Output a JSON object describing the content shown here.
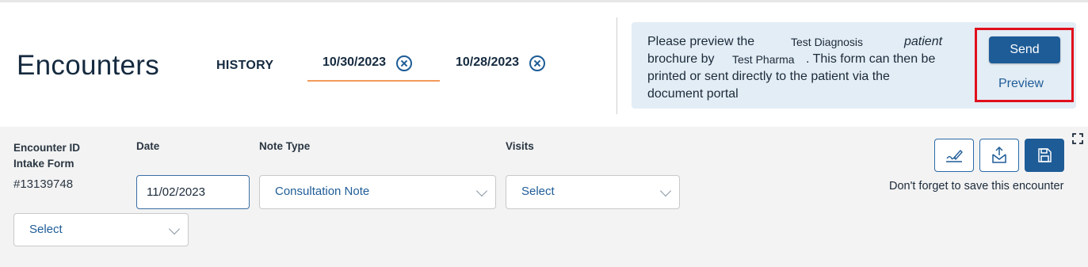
{
  "page": {
    "title": "Encounters"
  },
  "tabs": {
    "history_label": "HISTORY",
    "items": [
      {
        "label": "10/30/2023",
        "active": true
      },
      {
        "label": "10/28/2023",
        "active": false
      }
    ]
  },
  "notice": {
    "w1": "Please preview the",
    "diagnosis": "Test Diagnosis",
    "patient": "patient",
    "w2": "brochure by",
    "pharma": "Test Pharma",
    "w3": ". This form can then be",
    "w4": "printed or sent directly to the patient via the",
    "w5": "document portal",
    "send_label": "Send",
    "preview_label": "Preview"
  },
  "form": {
    "encounter_id_label": "Encounter ID",
    "intake_form_label": "Intake Form",
    "encounter_number": "#13139748",
    "date_label": "Date",
    "date_value": "11/02/2023",
    "note_type_label": "Note Type",
    "note_type_value": "Consultation Note",
    "visits_label": "Visits",
    "visits_value": "Select",
    "extra_select_value": "Select",
    "save_hint": "Don't forget to save this encounter"
  },
  "colors": {
    "accent": "#1e5c97",
    "tab_underline": "#f39a5a",
    "highlight": "#e0101c",
    "notice_bg": "#e3edf5"
  },
  "icons": [
    "close-circle-icon",
    "signature-icon",
    "envelope-export-icon",
    "save-icon",
    "expand-icon",
    "chevron-down-icon"
  ]
}
